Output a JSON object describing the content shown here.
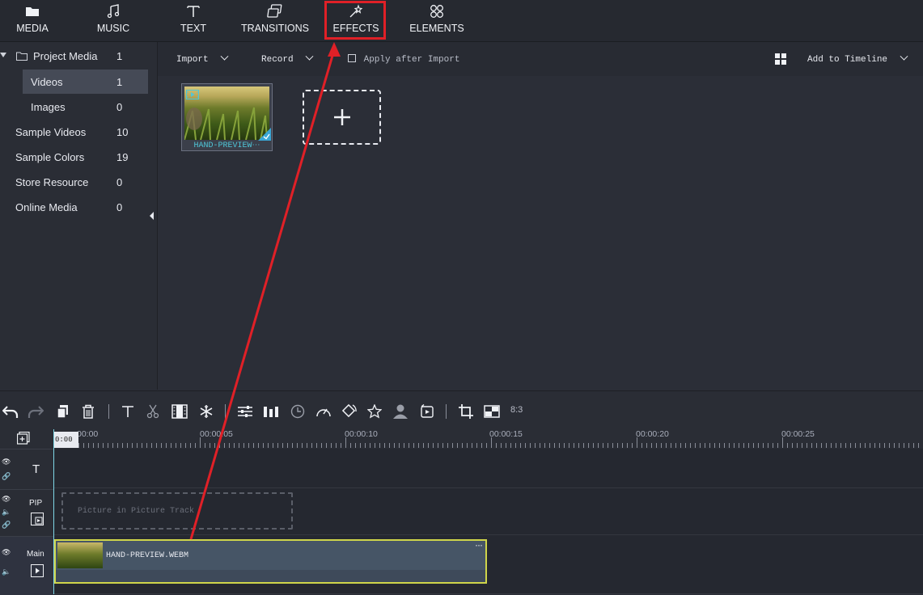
{
  "tabs": [
    {
      "label": "MEDIA",
      "icon": "folder-icon"
    },
    {
      "label": "MUSIC",
      "icon": "music-note-icon"
    },
    {
      "label": "TEXT",
      "icon": "text-icon"
    },
    {
      "label": "TRANSITIONS",
      "icon": "transitions-icon"
    },
    {
      "label": "EFFECTS",
      "icon": "magic-wand-icon"
    },
    {
      "label": "ELEMENTS",
      "icon": "elements-icon"
    }
  ],
  "sidebar": {
    "items": [
      {
        "label": "Project Media",
        "count": "1"
      },
      {
        "label": "Videos",
        "count": "1"
      },
      {
        "label": "Images",
        "count": "0"
      },
      {
        "label": "Sample Videos",
        "count": "10"
      },
      {
        "label": "Sample Colors",
        "count": "19"
      },
      {
        "label": "Store Resource",
        "count": "0"
      },
      {
        "label": "Online Media",
        "count": "0"
      }
    ]
  },
  "media_toolbar": {
    "import": "Import",
    "record": "Record",
    "apply_after_import": "Apply after Import",
    "add_to_timeline": "Add to Timeline"
  },
  "media": {
    "clip_caption": "HAND-PREVIEW⋯"
  },
  "timeline": {
    "aspect": "8:3",
    "ruler_labels": [
      "00:00:00:00",
      "00:00:00:05",
      "00:00:00:10",
      "00:00:00:15",
      "00:00:00:20",
      "00:00:00:25"
    ],
    "ruler_display": [
      "00:00",
      "00:00:05",
      "00:00:10",
      "00:00:15",
      "00:00:20",
      "00:00:25"
    ],
    "playhead_label": "0:00",
    "tracks": {
      "text_label": "T",
      "pip_label": "PIP",
      "pip_placeholder": "Picture in Picture Track",
      "main_label": "Main"
    },
    "clip_name": "HAND-PREVIEW.WEBM"
  },
  "colors": {
    "highlight": "#e02027",
    "accent": "#4fc6d8",
    "clip_border": "#cfd54a"
  }
}
